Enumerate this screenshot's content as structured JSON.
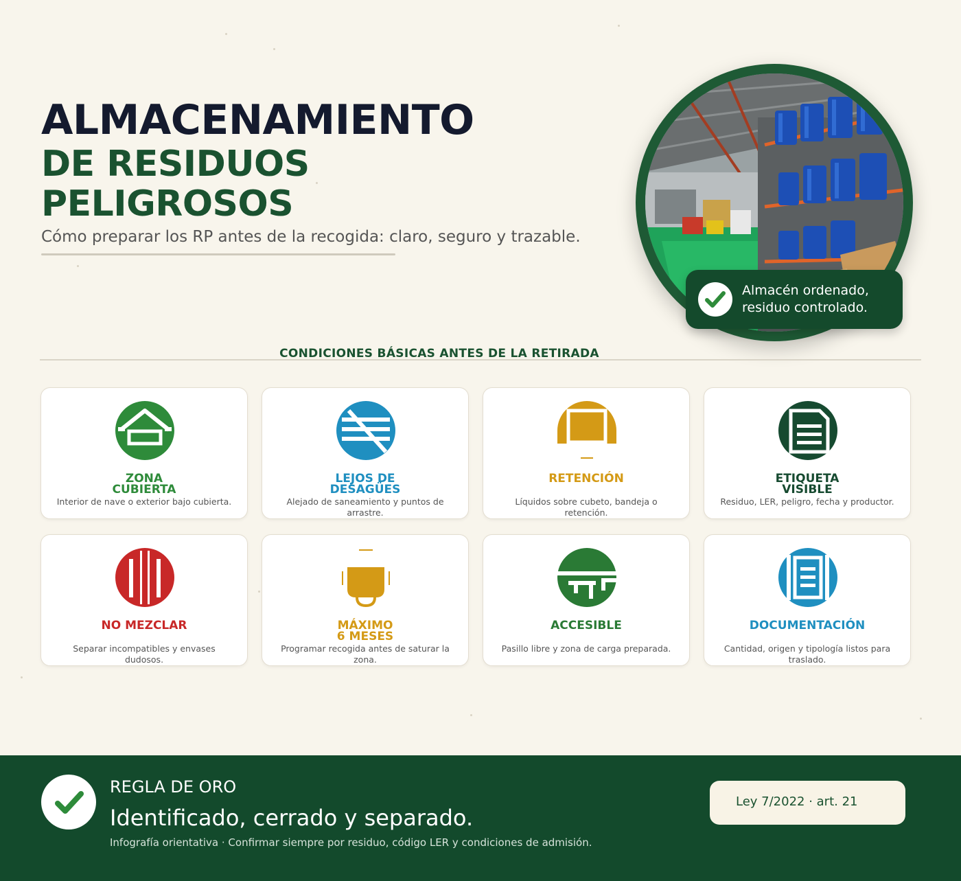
{
  "header": {
    "title_line1": "ALMACENAMIENTO",
    "title_line2": "DE RESIDUOS",
    "title_line3": "PELIGROSOS",
    "subtitle": "Cómo preparar los RP antes de la recogida: claro, seguro y trazable."
  },
  "photo_badge": {
    "line1": "Almacén ordenado,",
    "line2": "residuo controlado."
  },
  "section": {
    "heading": "CONDICIONES BÁSICAS ANTES DE LA RETIRADA"
  },
  "cards": [
    {
      "title_line1": "ZONA",
      "title_line2": "CUBIERTA",
      "desc": "Interior de nave o exterior bajo cubierta.",
      "color": "#2e8b3a",
      "icon": "roof-icon"
    },
    {
      "title_line1": "LEJOS DE",
      "title_line2": "DESAGÜES",
      "desc": "Alejado de saneamiento y puntos de arrastre.",
      "color": "#1f8fc0",
      "icon": "no-drain-icon"
    },
    {
      "title_line1": "RETENCIÓN",
      "title_line2": "",
      "desc": "Líquidos sobre cubeto, bandeja o retención.",
      "color": "#d49a16",
      "icon": "containment-tray-icon"
    },
    {
      "title_line1": "ETIQUETA",
      "title_line2": "VISIBLE",
      "desc": "Residuo, LER, peligro, fecha y productor.",
      "color": "#164a30",
      "icon": "label-icon"
    },
    {
      "title_line1": "NO MEZCLAR",
      "title_line2": "",
      "desc": "Separar incompatibles y envases dudosos.",
      "color": "#c82828",
      "icon": "separate-containers-icon"
    },
    {
      "title_line1": "MÁXIMO",
      "title_line2": "6 MESES",
      "desc": "Programar recogida antes de saturar la zona.",
      "color": "#d49a16",
      "icon": "container-time-icon"
    },
    {
      "title_line1": "ACCESIBLE",
      "title_line2": "",
      "desc": "Pasillo libre y zona de carga preparada.",
      "color": "#2a7a35",
      "icon": "access-truck-icon"
    },
    {
      "title_line1": "DOCUMENTACIÓN",
      "title_line2": "",
      "desc": "Cantidad, origen y tipología listos para traslado.",
      "color": "#1f8fc0",
      "icon": "document-icon"
    }
  ],
  "footer": {
    "kicker": "REGLA DE ORO",
    "title": "Identificado, cerrado y separado.",
    "note": "Infografía orientativa · Confirmar siempre por residuo, código LER y condiciones de admisión.",
    "law": "Ley 7/2022 · art. 21"
  },
  "colors": {
    "brand_dark": "#134a2c",
    "brand_green": "#1a5230",
    "title_navy": "#141a2e",
    "background": "#f8f5ec"
  }
}
